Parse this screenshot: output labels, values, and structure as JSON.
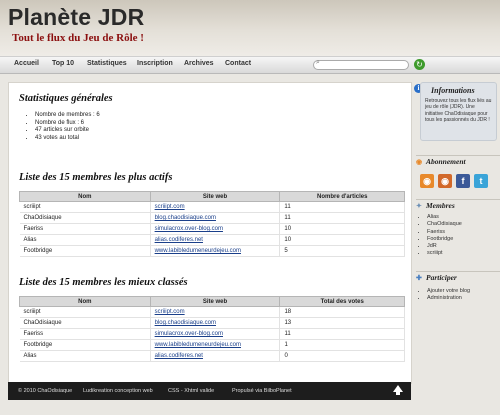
{
  "header": {
    "title": "Planète JDR",
    "tagline": "Tout le flux du Jeu de Rôle !"
  },
  "nav": {
    "items": [
      "Accueil",
      "Top 10",
      "Statistiques",
      "Inscription",
      "Archives",
      "Contact"
    ],
    "search_value": ""
  },
  "main": {
    "stats_title": "Statistiques générales",
    "stats": [
      "Nombre de membres : 6",
      "Nombre de flux : 6",
      "47 articles sur orbite",
      "43 votes au total"
    ],
    "active_title": "Liste des 15 membres les plus actifs",
    "active_headers": [
      "Nom",
      "Site web",
      "Nombre d'articles"
    ],
    "active_rows": [
      [
        "scriiipt",
        "scriiipt.com",
        "11"
      ],
      [
        "ChaOdisiaque",
        "blog.chaodisiaque.com",
        "11"
      ],
      [
        "Faeriss",
        "simulacrox.over-blog.com",
        "10"
      ],
      [
        "Alias",
        "alias.codiferes.net",
        "10"
      ],
      [
        "Footbridge",
        "www.labibledumeneurdejeu.com",
        "5"
      ]
    ],
    "ranked_title": "Liste des 15 membres les mieux classés",
    "ranked_headers": [
      "Nom",
      "Site web",
      "Total des votes"
    ],
    "ranked_rows": [
      [
        "scriiipt",
        "scriiipt.com",
        "18"
      ],
      [
        "ChaOdisiaque",
        "blog.chaodisiaque.com",
        "13"
      ],
      [
        "Faeriss",
        "simulacrox.over-blog.com",
        "11"
      ],
      [
        "Footbridge",
        "www.labibledumeneurdejeu.com",
        "1"
      ],
      [
        "Alias",
        "alias.codiferes.net",
        "0"
      ]
    ]
  },
  "footer": {
    "copyright": "© 2010 ChaOdisiaque",
    "design": "Ludikreation conception web",
    "validity": "CSS - Xhtml valide",
    "powered": "Propulsé via BilboPlanet"
  },
  "sidebar": {
    "info_title": "Informations",
    "info_text": "Retrouvez tous les flux liés au jeu de rôle (JDR). Une initiative ChaOdisiaque pour tous les passionnés du JDR !",
    "subscribe_title": "Abonnement",
    "social_icons": [
      "rss-icon",
      "rss-icon",
      "facebook-icon",
      "twitter-icon"
    ],
    "social_colors": [
      "#e8892a",
      "#d2692a",
      "#3b5998",
      "#3aa4d8"
    ],
    "members_title": "Membres",
    "members": [
      "Alias",
      "ChaOdisiaque",
      "Faeriss",
      "Footbridge",
      "JdR",
      "scriiipt"
    ],
    "participate_title": "Participer",
    "participate": [
      "Ajouter votre blog",
      "Administration"
    ]
  }
}
